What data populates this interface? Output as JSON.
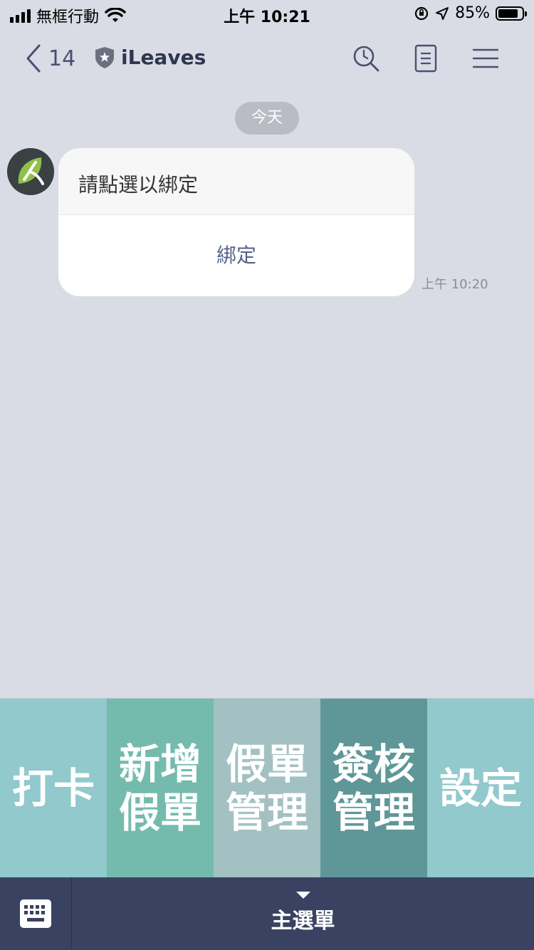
{
  "status_bar": {
    "carrier": "無框行動",
    "time": "上午 10:21",
    "battery": "85%",
    "battery_level": 0.85
  },
  "header": {
    "back_count": "14",
    "title": "iLeaves"
  },
  "chat": {
    "date_label": "今天",
    "message": {
      "text": "請點選以綁定",
      "action_label": "綁定",
      "time": "上午 10:20"
    }
  },
  "rich_menu": {
    "items": [
      {
        "label": "打卡",
        "color": "#91c9cc"
      },
      {
        "label": "新增假單",
        "color": "#74bbad"
      },
      {
        "label": "假單管理",
        "color": "#a3c1c2"
      },
      {
        "label": "簽核管理",
        "color": "#5f9798"
      },
      {
        "label": "設定",
        "color": "#91c9cc"
      }
    ]
  },
  "bottom_bar": {
    "menu_label": "主選單",
    "keyboard_icon": "keyboard-icon"
  }
}
